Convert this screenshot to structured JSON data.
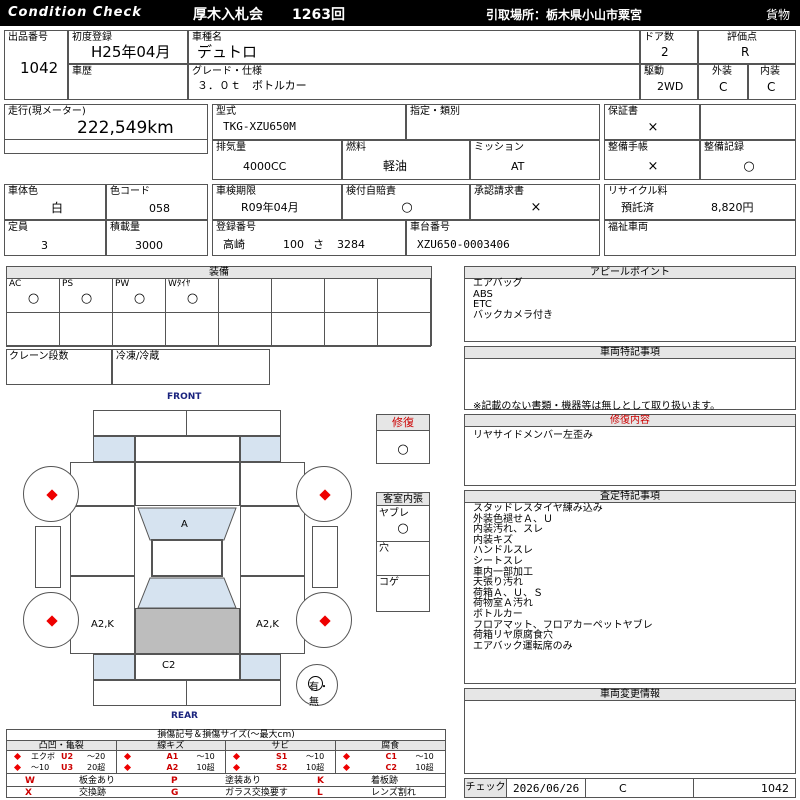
{
  "header": {
    "brand": "Condition Check",
    "auction": "厚木入札会",
    "session": "1263回",
    "pickup": "引取場所：栃木県小山市粟宮",
    "category": "貨物"
  },
  "row1": {
    "lot_label": "出品番号",
    "lot_value": "1042",
    "first_reg_label": "初度登録",
    "first_reg_value": "H25年04月",
    "car_name_label": "車種名",
    "car_name_value": "デュトロ",
    "doors_label": "ドア数",
    "doors_value": "2",
    "score_label": "評価点",
    "score_value": "R",
    "history_label": "車歴",
    "grade_label": "グレード・仕様",
    "grade_value": "３．０ｔ　ボトルカー",
    "drive_label": "駆動",
    "drive_value": "2WD",
    "ext_label": "外装",
    "ext_value": "C",
    "int_label": "内装",
    "int_value": "C"
  },
  "row2": {
    "mileage_label": "走行(現メーター)",
    "mileage_value": "222,549km",
    "model_label": "型式",
    "model_value": "TKG-XZU650M",
    "designation_label": "指定・類別",
    "warranty_label": "保証書",
    "warranty_value": "×",
    "displacement_label": "排気量",
    "displacement_value": "4000CC",
    "fuel_label": "燃料",
    "fuel_value": "軽油",
    "mission_label": "ミッション",
    "mission_value": "AT",
    "manual_label": "整備手帳",
    "manual_value": "×",
    "record_label": "整備記録",
    "record_value": "○"
  },
  "row3": {
    "body_color_label": "車体色",
    "body_color_value": "白",
    "color_code_label": "色コード",
    "color_code_value": "058",
    "inspection_label": "車検期限",
    "inspection_value": "R09年04月",
    "insurance_label": "検付自賠責",
    "insurance_value": "○",
    "approval_label": "承認請求書",
    "approval_value": "×",
    "recycle_label": "リサイクル料",
    "recycle_status": "預託済",
    "recycle_value": "8,820円",
    "capacity_label": "定員",
    "capacity_value": "3",
    "load_label": "積載量",
    "load_value": "3000",
    "reg_no_label": "登録番号",
    "reg_no_area": "高崎",
    "reg_no_class": "100",
    "reg_no_kana": "さ",
    "reg_no_num": "3284",
    "chassis_label": "車台番号",
    "chassis_value": "XZU650-0003406",
    "welfare_label": "福祉車両"
  },
  "equipment": {
    "title": "装備",
    "items": [
      {
        "label": "AC",
        "mark": "○"
      },
      {
        "label": "PS",
        "mark": "○"
      },
      {
        "label": "PW",
        "mark": "○"
      },
      {
        "label": "Wﾀｲﾔ",
        "mark": "○"
      }
    ],
    "crane_label": "クレーン段数",
    "fridge_label": "冷凍/冷蔵"
  },
  "diagram": {
    "front": "FRONT",
    "rear": "REAR",
    "mark_a": "A",
    "mark_left": "A2,K",
    "mark_right": "A2,K",
    "mark_rear": "C2",
    "repair_label": "修復",
    "repair_mark": "○",
    "cabin_title": "客室内張",
    "cabin_tear": "ヤブレ",
    "cabin_tear_mark": "○",
    "cabin_hole": "穴",
    "cabin_burn": "コゲ",
    "yes_no": "有・無"
  },
  "appeal": {
    "title": "アピールポイント",
    "lines": [
      "エアバッグ",
      "ABS",
      "ETC",
      "バックカメラ付き"
    ]
  },
  "special": {
    "title": "車両特記事項",
    "note": "※記載のない書類・機器等は無しとして取り扱います。"
  },
  "repair_detail": {
    "title": "修復内容",
    "text": "リヤサイドメンバー左歪み"
  },
  "inspection_notes": {
    "title": "査定特記事項",
    "lines": [
      "スタッドレスタイヤ練み込み",
      "外装色褪せＡ、Ｕ",
      "内装汚れ、スレ",
      "内装キズ",
      "ハンドルスレ",
      "シートスレ",
      "車内一部加工",
      "天張り汚れ",
      "荷箱Ａ、Ｕ、Ｓ",
      "荷物室Ａ汚れ",
      "ボトルカー",
      "フロアマット、フロアカーペットヤブレ",
      "荷箱リヤ原腐食穴",
      "エアバック運転席のみ"
    ]
  },
  "change_info": {
    "title": "車両変更情報"
  },
  "legend": {
    "title": "損傷記号＆損傷サイズ(〜最大cm)",
    "groups": [
      {
        "name": "凸凹・亀裂",
        "c1": "エクボ",
        "c2": "U2",
        "c3": "〜20",
        "d1": "〜10",
        "d2": "U3",
        "d3": "20超"
      },
      {
        "name": "線キズ",
        "c1": "A1",
        "c2": "〜10",
        "d1": "A2",
        "d2": "10超"
      },
      {
        "name": "サビ",
        "c1": "S1",
        "c2": "〜10",
        "d1": "S2",
        "d2": "10超"
      },
      {
        "name": "腐食",
        "c1": "C1",
        "c2": "〜10",
        "d1": "C2",
        "d2": "10超"
      }
    ],
    "codes": [
      {
        "k": "W",
        "v": "板金あり",
        "k2": "P",
        "v2": "塗装あり",
        "k3": "K",
        "v3": "着板跡"
      },
      {
        "k": "X",
        "v": "交換跡",
        "k2": "G",
        "v2": "ガラス交換要す",
        "k3": "L",
        "v3": "レンズ割れ"
      }
    ]
  },
  "check": {
    "label": "チェック",
    "date": "2026/06/26",
    "grade": "C",
    "lot": "1042"
  },
  "colors": {
    "header_bg": "#000000",
    "highlight": "#d6e3f0",
    "damage_red": "#e00000",
    "repair_red": "#cc0000"
  }
}
